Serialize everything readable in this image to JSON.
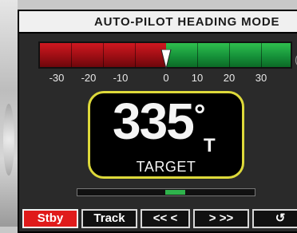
{
  "title": "AUTO-PILOT HEADING MODE",
  "scale": {
    "ticks": [
      "-30",
      "-20",
      "-10",
      "0",
      "10",
      "20",
      "30"
    ],
    "edge_char": "("
  },
  "heading": {
    "value": "335",
    "degree_symbol": "°",
    "reference": "T",
    "caption": "TARGET"
  },
  "rudder": {
    "indicator": "green segment near center"
  },
  "buttons": {
    "standby": "Stby",
    "track": "Track",
    "left": "<<  <",
    "right": ">  >>",
    "rotate": "↺"
  },
  "colors": {
    "port": "#c1121a",
    "starboard": "#1e9e3e",
    "frame": "#ddd93a",
    "standby": "#e01b1b"
  }
}
